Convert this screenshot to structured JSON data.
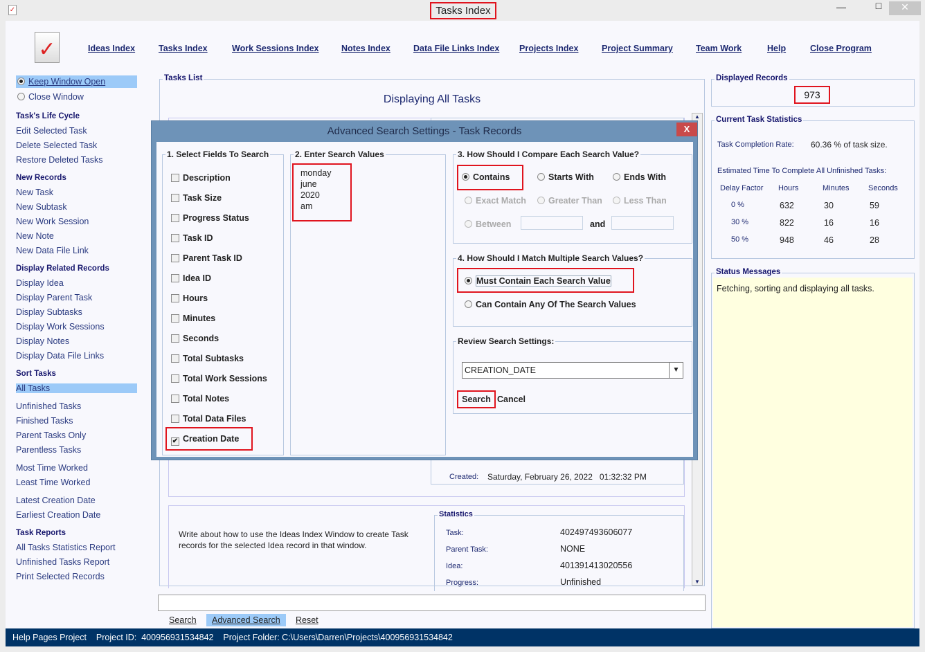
{
  "window": {
    "title": "Tasks Index",
    "minimize": "—",
    "maximize": "□",
    "close": "✕"
  },
  "nav": [
    "Ideas Index",
    "Tasks Index",
    "Work Sessions Index",
    "Notes Index",
    "Data File Links Index",
    "Projects Index",
    "Project Summary",
    "Team Work",
    "Help",
    "Close Program"
  ],
  "window_option": {
    "keep_open": "Keep Window Open",
    "close": "Close Window",
    "selected": "keep_open"
  },
  "sidebar": {
    "life_cycle": {
      "title": "Task's Life Cycle",
      "items": [
        "Edit Selected Task",
        "Delete Selected Task",
        "Restore Deleted Tasks"
      ]
    },
    "new_records": {
      "title": "New Records",
      "items": [
        "New Task",
        "New Subtask",
        "New Work Session",
        "New Note",
        "New Data File Link"
      ]
    },
    "display_related": {
      "title": "Display Related Records",
      "items": [
        "Display Idea",
        "Display Parent Task",
        "Display Subtasks",
        "Display Work Sessions",
        "Display Notes",
        "Display Data File Links"
      ]
    },
    "sort": {
      "title": "Sort Tasks",
      "groups": [
        [
          "All Tasks"
        ],
        [
          "Unfinished Tasks",
          "Finished Tasks",
          "Parent Tasks Only",
          "Parentless Tasks"
        ],
        [
          "Most Time Worked",
          "Least Time Worked"
        ],
        [
          "Latest Creation Date",
          "Earliest Creation Date"
        ]
      ],
      "selected": "All Tasks"
    },
    "reports": {
      "title": "Task Reports",
      "items": [
        "All Tasks Statistics Report",
        "Unfinished Tasks Report",
        "Print Selected Records"
      ]
    }
  },
  "tasks_list": {
    "legend": "Tasks List",
    "heading": "Displaying All Tasks",
    "record": {
      "created_label": "Created:",
      "created_value": "Saturday, February 26, 2022   01:32:32 PM",
      "description": "Write about how to use the Ideas Index Window to create Task records for the selected Idea record in that window.",
      "statistics_legend": "Statistics",
      "stats": [
        {
          "label": "Task:",
          "value": "402497493606077"
        },
        {
          "label": "Parent Task:",
          "value": "NONE"
        },
        {
          "label": "Idea:",
          "value": "401391413020556"
        },
        {
          "label": "Progress:",
          "value": "Unfinished"
        }
      ]
    }
  },
  "search_bar": {
    "value": "",
    "search": "Search",
    "advanced": "Advanced Search",
    "reset": "Reset"
  },
  "displayed_records": {
    "legend": "Displayed Records",
    "value": "973"
  },
  "task_stats": {
    "legend": "Current Task Statistics",
    "completion_label": "Task Completion Rate:",
    "completion_value": "60.36 % of task size.",
    "estimate_label": "Estimated Time To Complete All Unfinished Tasks:",
    "headers": [
      "Delay Factor",
      "Hours",
      "Minutes",
      "Seconds"
    ],
    "rows": [
      [
        "0 %",
        "632",
        "30",
        "59"
      ],
      [
        "30 %",
        "822",
        "16",
        "16"
      ],
      [
        "50 %",
        "948",
        "46",
        "28"
      ]
    ]
  },
  "status": {
    "legend": "Status Messages",
    "message": "Fetching, sorting and displaying all tasks."
  },
  "statusbar": {
    "project": "Help Pages Project",
    "project_id": "Project ID:  400956931534842",
    "folder": "Project Folder: C:\\Users\\Darren\\Projects\\400956931534842"
  },
  "dialog": {
    "title": "Advanced Search Settings - Task Records",
    "close": "X",
    "fields_legend": "1. Select Fields To Search",
    "fields": [
      {
        "label": "Description",
        "checked": false
      },
      {
        "label": "Task Size",
        "checked": false
      },
      {
        "label": "Progress Status",
        "checked": false
      },
      {
        "label": "Task ID",
        "checked": false
      },
      {
        "label": "Parent Task ID",
        "checked": false
      },
      {
        "label": "Idea ID",
        "checked": false
      },
      {
        "label": "Hours",
        "checked": false
      },
      {
        "label": "Minutes",
        "checked": false
      },
      {
        "label": "Seconds",
        "checked": false
      },
      {
        "label": "Total Subtasks",
        "checked": false
      },
      {
        "label": "Total Work Sessions",
        "checked": false
      },
      {
        "label": "Total Notes",
        "checked": false
      },
      {
        "label": "Total Data Files",
        "checked": false
      },
      {
        "label": "Creation Date",
        "checked": true
      }
    ],
    "values_legend": "2. Enter Search Values",
    "values": [
      "monday",
      "june",
      "2020",
      "am"
    ],
    "compare_legend": "3. How Should I Compare Each Search Value?",
    "compare": {
      "contains": "Contains",
      "starts": "Starts With",
      "ends": "Ends With",
      "exact": "Exact Match",
      "greater": "Greater Than",
      "less": "Less Than",
      "between": "Between",
      "and": "and",
      "selected": "Contains"
    },
    "match_legend": "4. How Should I Match Multiple Search Values?",
    "match": {
      "each": "Must Contain Each Search Value",
      "any": "Can Contain Any Of The Search Values",
      "selected": "each"
    },
    "review_legend": "Review Search Settings:",
    "review_value": "CREATION_DATE",
    "search": "Search",
    "cancel": "Cancel"
  },
  "colors": {
    "accent": "#9ccaf8",
    "highlight": "#e0141e",
    "dialog_title": "#6e93b8",
    "statusbar": "#003366",
    "status_bg": "#ffffe0"
  }
}
